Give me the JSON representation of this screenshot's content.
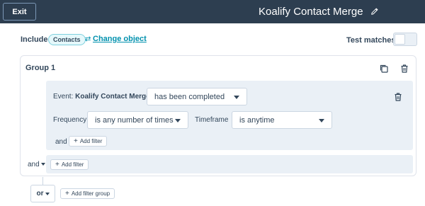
{
  "header": {
    "exit_label": "Exit",
    "title": "Koalify Contact Merge",
    "edit_icon": "pencil-icon"
  },
  "include": {
    "label": "Include",
    "object_badge": "Contacts",
    "change_object_icon": "swap-arrows-icon",
    "change_object_label": "Change object"
  },
  "test_matches": {
    "label": "Test matches",
    "toggle_on": false
  },
  "group": {
    "title": "Group 1",
    "copy_icon": "copy-icon",
    "delete_icon": "trash-icon",
    "filter": {
      "event_prefix": "Event:",
      "event_name": "Koalify Contact Merge",
      "event_status": "has been completed",
      "delete_icon": "trash-icon",
      "frequency_label": "Frequency",
      "frequency_value": "is any number of times",
      "timeframe_label": "Timeframe",
      "timeframe_value": "is anytime",
      "and_label": "and",
      "add_filter_label": "Add filter"
    },
    "and_label": "and",
    "add_filter_label": "Add filter"
  },
  "footer": {
    "or_label": "or",
    "add_filter_group_label": "Add filter group"
  },
  "colors": {
    "topbar": "#2d3e50",
    "link": "#0091ae",
    "panel": "#eaf0f6",
    "border": "#cbd6e2",
    "text": "#33475b"
  }
}
